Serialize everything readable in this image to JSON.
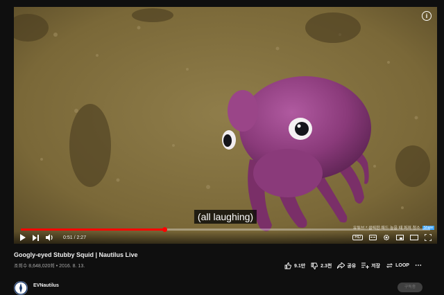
{
  "video": {
    "subtitle": "(all laughing)",
    "time_display": "0:51 / 2:27",
    "progress_fraction": 0.35,
    "watermark_text": "유튜브 * 클릭한 애드 높을 때 퍼져 청소",
    "watermark_tag": "Share"
  },
  "controls": {
    "play_icon": "play-icon",
    "next_icon": "next-icon",
    "volume_icon": "volume-icon",
    "hd_label": "HD",
    "subtitles_icon": "subtitles-icon",
    "settings_icon": "gear-icon",
    "miniplayer_icon": "miniplayer-icon",
    "theater_icon": "theater-icon",
    "fullscreen_icon": "fullscreen-icon"
  },
  "title": "Googly-eyed Stubby Squid | Nautilus Live",
  "meta": "조회수 8,648,020회 • 2016. 8. 13.",
  "actions": {
    "likes": "9.1만",
    "dislikes": "2.3천",
    "share": "공유",
    "save": "저장",
    "loop": "LOOP",
    "more": "⋯"
  },
  "channel": {
    "name": "EVNautilus",
    "subscribe": "구독중"
  },
  "colors": {
    "accent": "#ff0000",
    "background": "#0f0f0f",
    "seafloor": "#7d6a3c",
    "squid": "#8a3a7a"
  }
}
